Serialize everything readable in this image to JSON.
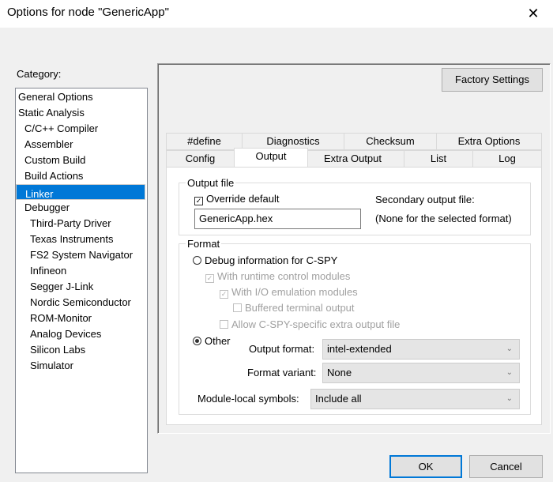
{
  "window": {
    "title": "Options for node \"GenericApp\"",
    "close": "✕"
  },
  "category": {
    "label": "Category:",
    "items": [
      {
        "label": "General Options",
        "indent": 0
      },
      {
        "label": "Static Analysis",
        "indent": 0
      },
      {
        "label": "C/C++ Compiler",
        "indent": 1
      },
      {
        "label": "Assembler",
        "indent": 1
      },
      {
        "label": "Custom Build",
        "indent": 1
      },
      {
        "label": "Build Actions",
        "indent": 1
      },
      {
        "label": "Linker",
        "indent": 1,
        "selected": true
      },
      {
        "label": "Debugger",
        "indent": 1
      },
      {
        "label": "Third-Party Driver",
        "indent": 2
      },
      {
        "label": "Texas Instruments",
        "indent": 2
      },
      {
        "label": "FS2 System Navigator",
        "indent": 2
      },
      {
        "label": "Infineon",
        "indent": 2
      },
      {
        "label": "Segger J-Link",
        "indent": 2
      },
      {
        "label": "Nordic Semiconductor",
        "indent": 2
      },
      {
        "label": "ROM-Monitor",
        "indent": 2
      },
      {
        "label": "Analog Devices",
        "indent": 2
      },
      {
        "label": "Silicon Labs",
        "indent": 2
      },
      {
        "label": "Simulator",
        "indent": 2
      }
    ]
  },
  "factory_settings": "Factory Settings",
  "tabs": {
    "row1": [
      "#define",
      "Diagnostics",
      "Checksum",
      "Extra Options"
    ],
    "row2": [
      "Config",
      "Output",
      "Extra Output",
      "List",
      "Log"
    ],
    "active": "Output"
  },
  "output_file": {
    "legend": "Output file",
    "override_label": "Override default",
    "override_checked": true,
    "filename": "GenericApp.hex",
    "secondary_label": "Secondary output file:",
    "secondary_value": "(None for the selected format)"
  },
  "format": {
    "legend": "Format",
    "debug_label": "Debug information for C-SPY",
    "runtime_label": "With runtime control modules",
    "io_label": "With I/O emulation modules",
    "buffered_label": "Buffered terminal output",
    "allow_label": "Allow C-SPY-specific extra output file",
    "other_label": "Other",
    "output_format_label": "Output format:",
    "output_format_value": "intel-extended",
    "variant_label": "Format variant:",
    "variant_value": "None",
    "module_label": "Module-local symbols:",
    "module_value": "Include all"
  },
  "buttons": {
    "ok": "OK",
    "cancel": "Cancel"
  },
  "colors": {
    "selection": "#0078d7"
  }
}
